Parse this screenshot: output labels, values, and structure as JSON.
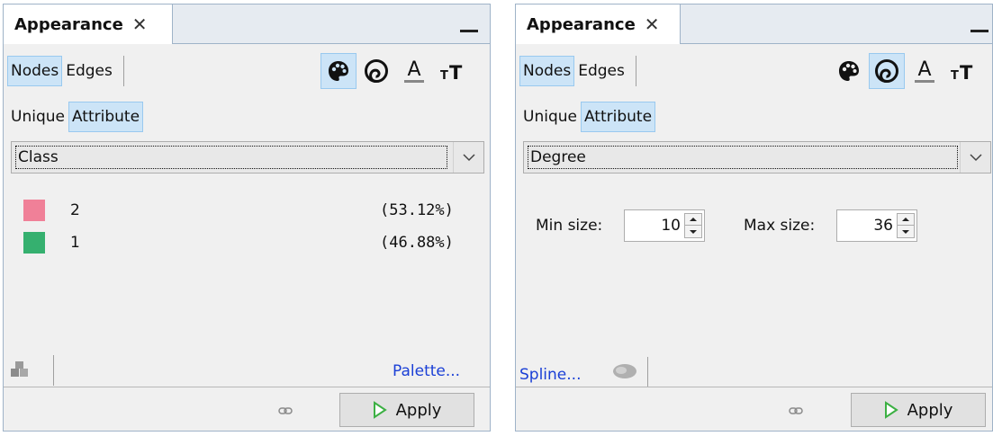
{
  "colors": {
    "selected_bg": "#cce4f7",
    "selected_border": "#99c9ef",
    "link": "#1a3fd6",
    "apply_arrow": "#3cb043",
    "class_2": "#f08098",
    "class_1": "#35b06f"
  },
  "left_panel": {
    "tab_title": "Appearance",
    "close_glyph": "✕",
    "element_tabs": {
      "nodes": "Nodes",
      "edges": "Edges",
      "selected": "nodes"
    },
    "tools": [
      {
        "icon": "palette-icon",
        "name": "color",
        "selected": true
      },
      {
        "icon": "size-icon",
        "name": "size",
        "selected": false
      },
      {
        "icon": "label-color-icon",
        "name": "label-color",
        "selected": false
      },
      {
        "icon": "label-size-icon",
        "name": "label-size",
        "selected": false
      }
    ],
    "mode_tabs": {
      "unique": "Unique",
      "attribute": "Attribute",
      "selected": "attribute"
    },
    "attribute_combo": {
      "value": "Class"
    },
    "legend": [
      {
        "label": "2",
        "percent": "(53.12%)",
        "color": "#f08098"
      },
      {
        "label": "1",
        "percent": "(46.88%)",
        "color": "#35b06f"
      }
    ],
    "palette_link": "Palette...",
    "apply_label": "Apply"
  },
  "right_panel": {
    "tab_title": "Appearance",
    "close_glyph": "✕",
    "element_tabs": {
      "nodes": "Nodes",
      "edges": "Edges",
      "selected": "nodes"
    },
    "tools": [
      {
        "icon": "palette-icon",
        "name": "color",
        "selected": false
      },
      {
        "icon": "size-icon",
        "name": "size",
        "selected": true
      },
      {
        "icon": "label-color-icon",
        "name": "label-color",
        "selected": false
      },
      {
        "icon": "label-size-icon",
        "name": "label-size",
        "selected": false
      }
    ],
    "mode_tabs": {
      "unique": "Unique",
      "attribute": "Attribute",
      "selected": "attribute"
    },
    "attribute_combo": {
      "value": "Degree"
    },
    "min_size_label": "Min size:",
    "min_size_value": "10",
    "max_size_label": "Max size:",
    "max_size_value": "36",
    "spline_link": "Spline...",
    "apply_label": "Apply"
  }
}
